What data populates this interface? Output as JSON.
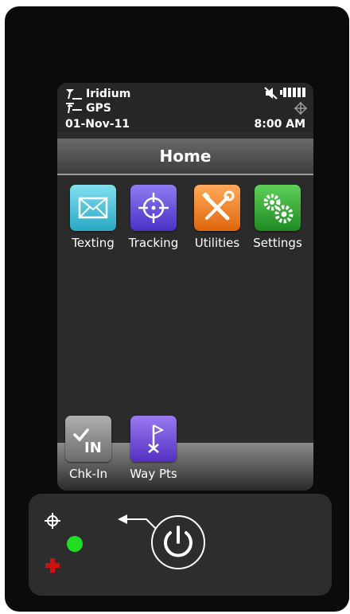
{
  "status": {
    "iridium_label": "Iridium",
    "gps_label": "GPS",
    "date": "01-Nov-11",
    "time": "8:00 AM"
  },
  "title": "Home",
  "apps": [
    {
      "label": "Texting",
      "icon": "envelope-icon",
      "color": "#3fb8cf"
    },
    {
      "label": "Tracking",
      "icon": "crosshair-icon",
      "color": "#5a3ed9"
    },
    {
      "label": "Utilities",
      "icon": "tools-icon",
      "color": "#f07a1a"
    },
    {
      "label": "Settings",
      "icon": "gears-icon",
      "color": "#2e9e33"
    }
  ],
  "dock_apps": [
    {
      "label": "Chk-In",
      "icon": "check-in-icon",
      "color": "#8c8c8c"
    },
    {
      "label": "Way Pts",
      "icon": "waypoint-flag-icon",
      "color": "#6a3fd0"
    }
  ],
  "panel": {
    "led_color": "#22dd22",
    "plus_color": "#cc1111"
  }
}
